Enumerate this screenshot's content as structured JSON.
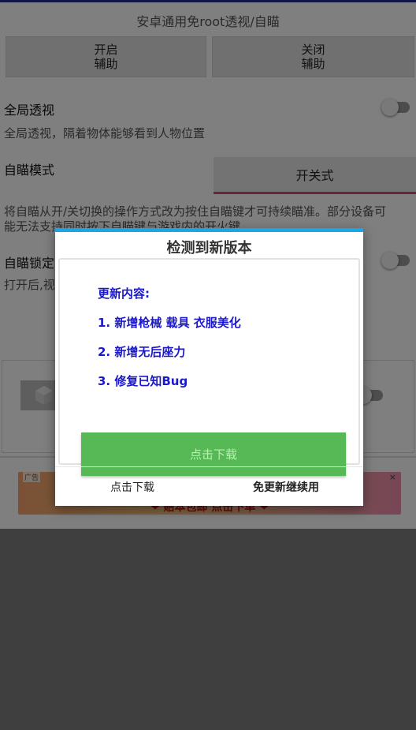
{
  "app": {
    "title": "安卓通用免root透视/自瞄",
    "enable_button": [
      "开启",
      "辅助"
    ],
    "disable_button": [
      "关闭",
      "辅助"
    ],
    "global_esp": {
      "label": "全局透视",
      "description": "全局透视，隔着物体能够看到人物位置",
      "enabled": false
    },
    "aim_mode": {
      "label": "自瞄模式",
      "selected": "开关式",
      "description_line1": "将自瞄从开/关切换的操作方式改为按住自瞄键才可持续瞄准。部分设备可",
      "description_line2": "能无法支持同时按下自瞄键与游戏内的开火键"
    },
    "aim_lock": {
      "label": "自瞄锁定",
      "description": "打开后,视",
      "enabled": false
    },
    "ad": {
      "tag": "广告",
      "text": "❤ 赔本包邮 点击下单 ❤",
      "close": "×"
    }
  },
  "dialog": {
    "title": "检测到新版本",
    "content_heading": "更新内容:",
    "items": [
      "1. 新增枪械 载具 衣服美化",
      "2. 新增无后座力",
      "3. 修复已知Bug"
    ],
    "download_button": "点击下载",
    "footer_left": "点击下载",
    "footer_right": "免更新继续用"
  },
  "colors": {
    "accent_blue": "#1aa5e6",
    "update_text": "#1a18c9",
    "download_green": "#57b956",
    "select_underline": "#d6457a"
  }
}
